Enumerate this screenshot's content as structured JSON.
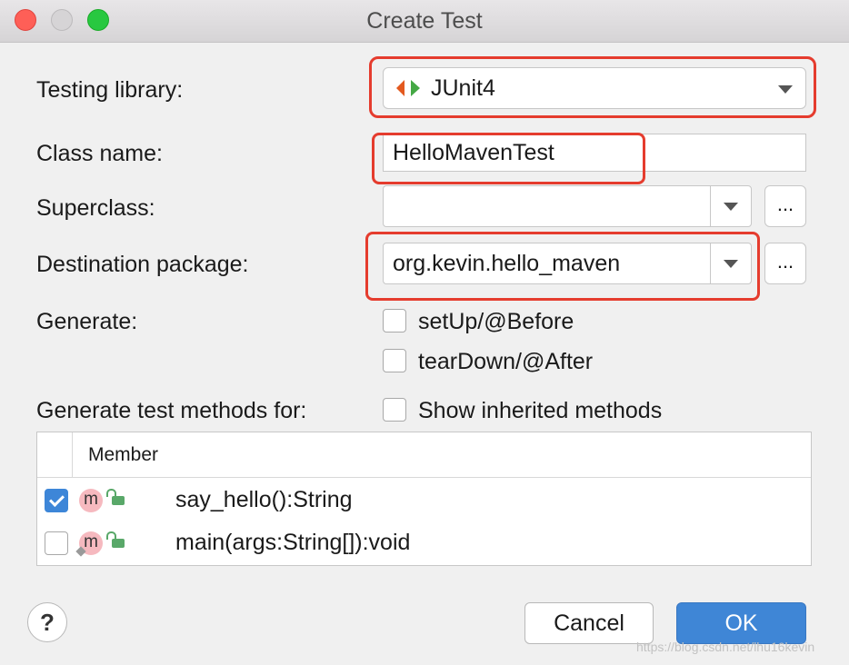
{
  "window": {
    "title": "Create Test"
  },
  "form": {
    "testing_library_label": "Testing library:",
    "testing_library_value": "JUnit4",
    "class_name_label": "Class name:",
    "class_name_value": "HelloMavenTest",
    "superclass_label": "Superclass:",
    "superclass_value": "",
    "superclass_browse": "...",
    "destination_label": "Destination package:",
    "destination_value": "org.kevin.hello_maven",
    "destination_browse": "...",
    "generate_label": "Generate:",
    "setup_label": "setUp/@Before",
    "setup_checked": false,
    "teardown_label": "tearDown/@After",
    "teardown_checked": false,
    "methods_label": "Generate test methods for:",
    "show_inherited_label": "Show inherited methods",
    "show_inherited_checked": false
  },
  "table": {
    "header": "Member",
    "rows": [
      {
        "checked": true,
        "icon": "method-icon",
        "icon_letter": "m",
        "text": "say_hello():String"
      },
      {
        "checked": false,
        "icon": "method-icon",
        "icon_letter": "m",
        "text": "main(args:String[]):void"
      }
    ]
  },
  "buttons": {
    "help": "?",
    "cancel": "Cancel",
    "ok": "OK"
  },
  "colors": {
    "accent": "#3f86d6",
    "highlight": "#e53c2e",
    "method_icon": "#f6b9bf",
    "lock": "#59a869"
  },
  "watermark": "https://blog.csdn.net/lhu16kevin"
}
